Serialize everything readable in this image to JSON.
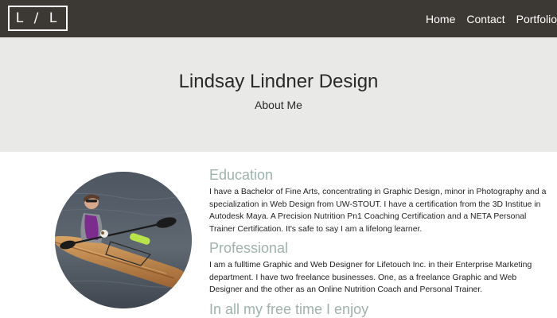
{
  "nav": {
    "logo": "L / L",
    "links": [
      "Home",
      "Contact",
      "Portfolio"
    ]
  },
  "hero": {
    "title": "Lindsay Lindner Design",
    "subtitle": "About Me"
  },
  "sections": [
    {
      "heading": "Education",
      "text": "I have a Bachelor of Fine Arts, concentrating in Graphic Design, minor in Photography and a specialization in Web Design from UW-STOUT. I have a certification from the 3D Institue in Autodesk Maya. A Precision Nutrition Pn1 Coaching Certification and a NETA Personal Trainer Certification. It's safe to say I am a lifelong learner."
    },
    {
      "heading": "Professional",
      "text": "I am a fulltime Graphic and Web Designer for Lifetouch Inc. in their Enterprise Marketing department. I have two freelance businesses. One, as a freelance Graphic and Web Designer and the other as an Online Nutrition Coach and Personal Trainer."
    },
    {
      "heading": "In all my free time I enjoy",
      "text": ""
    }
  ],
  "colors": {
    "navbar": "#3c3934",
    "hero": "#e9eae7",
    "heading_accent": "#9fb3ae"
  }
}
